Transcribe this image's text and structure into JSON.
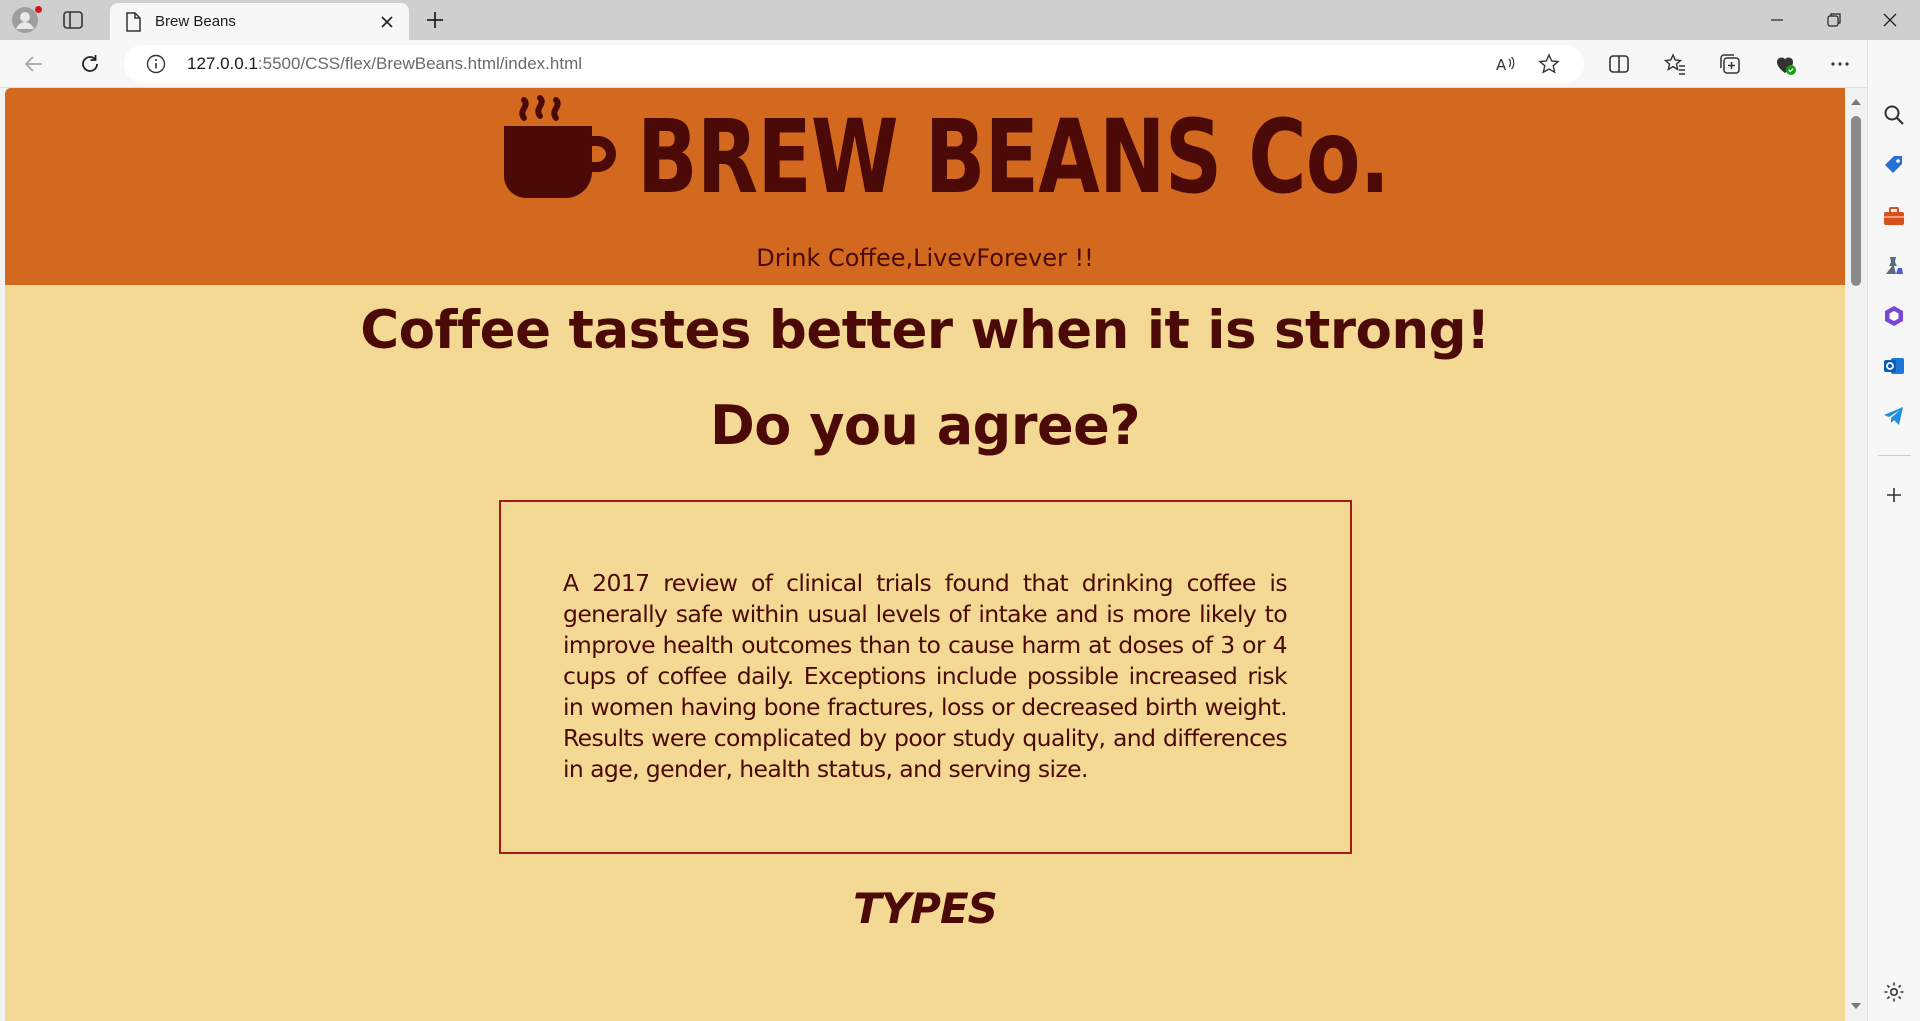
{
  "browser": {
    "tab_title": "Brew Beans",
    "url_host": "127.0.0.1",
    "url_path": ":5500/CSS/flex/BrewBeans.html/index.html",
    "icons": {
      "profile": "profile-icon",
      "tab_actions": "tab-actions-icon",
      "page": "page-icon",
      "close_tab": "close-icon",
      "new_tab": "plus-icon",
      "minimize": "minimize-icon",
      "restore": "restore-icon",
      "close_window": "close-icon",
      "back": "back-arrow-icon",
      "refresh": "refresh-icon",
      "info": "info-icon",
      "read_aloud": "read-aloud-icon",
      "favorite": "star-icon",
      "split": "split-screen-icon",
      "favorites": "favorites-icon",
      "collections": "collections-icon",
      "health": "browser-essentials-icon",
      "more": "more-icon",
      "copilot": "copilot-icon"
    }
  },
  "sidebar": {
    "icons": [
      "search-icon",
      "shopping-tag-icon",
      "tools-icon",
      "games-icon",
      "office-icon",
      "outlook-icon",
      "telegram-icon",
      "add-icon",
      "settings-icon"
    ]
  },
  "page": {
    "brand": "BREW BEANS Co.",
    "tagline": "Drink Coffee,LivevForever !!",
    "headline_prefix": "Coffee tastes better when it is ",
    "headline_strong": "strong!",
    "question": "Do you agree?",
    "fact": "A 2017 review of clinical trials found that drinking coffee is generally safe within usual levels of intake and is more likely to improve health outcomes than to cause harm at doses of 3 or 4 cups of coffee daily. Exceptions include possible increased risk in women having bone fractures, loss or decreased birth weight. Results were complicated by poor study quality, and differences in age, gender, health status, and serving size.",
    "section_heading": "TYPES"
  },
  "colors": {
    "hero_bg": "#d2691e",
    "page_bg": "#f4d994",
    "text_dark": "#4b0a08",
    "box_border": "#a01a1a"
  }
}
